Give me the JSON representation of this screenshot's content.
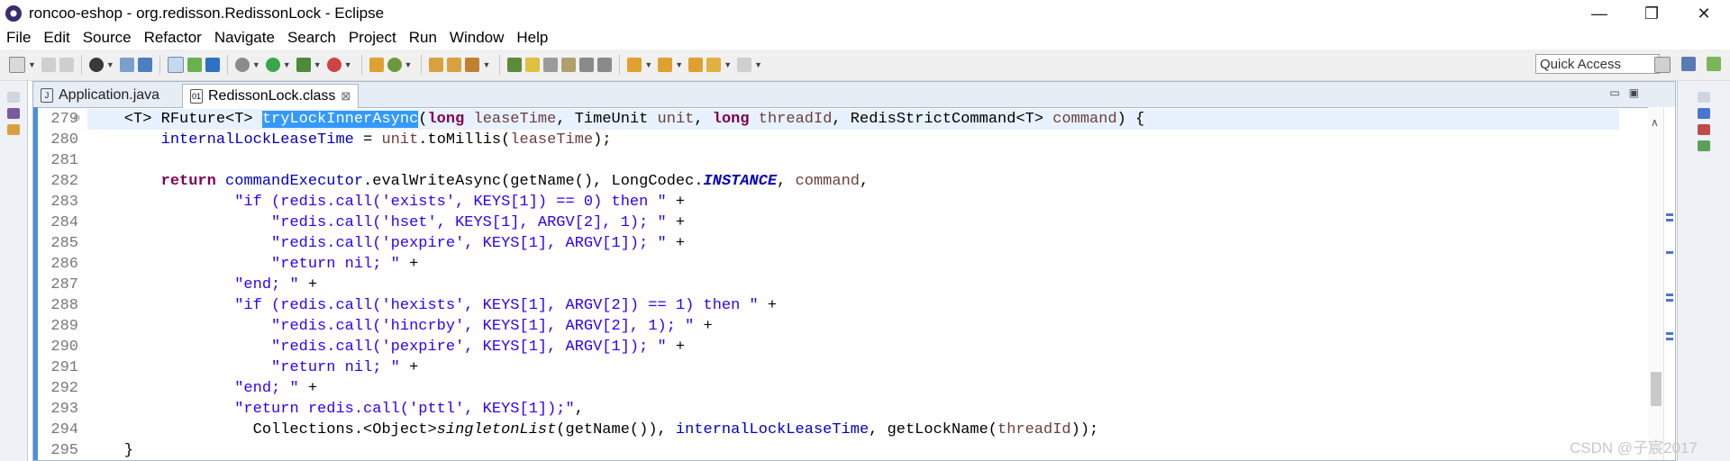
{
  "window": {
    "title": "roncoo-eshop - org.redisson.RedissonLock - Eclipse",
    "minimize": "—",
    "restore": "❐",
    "close": "✕"
  },
  "menu": [
    "File",
    "Edit",
    "Source",
    "Refactor",
    "Navigate",
    "Search",
    "Project",
    "Run",
    "Window",
    "Help"
  ],
  "toolbar": {
    "quick_access": "Quick Access"
  },
  "tabs": [
    {
      "label": "Application.java",
      "icon": "java-file-icon"
    },
    {
      "label": "RedissonLock.class",
      "icon": "class-file-icon",
      "close": "⊠"
    }
  ],
  "editor": {
    "line_numbers": [
      "279",
      "280",
      "281",
      "282",
      "283",
      "284",
      "285",
      "286",
      "287",
      "288",
      "289",
      "290",
      "291",
      "292",
      "293",
      "294",
      "295"
    ],
    "current_line": "279",
    "selected_text": "tryLockInnerAsync",
    "lines": [
      [
        {
          "t": "    <T> RFuture<T> ",
          "c": ""
        },
        {
          "t": "tryLockInnerAsync",
          "c": "sel"
        },
        {
          "t": "(",
          "c": ""
        },
        {
          "t": "long",
          "c": "kw"
        },
        {
          "t": " ",
          "c": ""
        },
        {
          "t": "leaseTime",
          "c": "par"
        },
        {
          "t": ", TimeUnit ",
          "c": ""
        },
        {
          "t": "unit",
          "c": "par"
        },
        {
          "t": ", ",
          "c": ""
        },
        {
          "t": "long",
          "c": "kw"
        },
        {
          "t": " ",
          "c": ""
        },
        {
          "t": "threadId",
          "c": "par"
        },
        {
          "t": ", RedisStrictCommand<T> ",
          "c": ""
        },
        {
          "t": "command",
          "c": "par"
        },
        {
          "t": ") {",
          "c": ""
        }
      ],
      [
        {
          "t": "        ",
          "c": ""
        },
        {
          "t": "internalLockLeaseTime",
          "c": "fld"
        },
        {
          "t": " = ",
          "c": ""
        },
        {
          "t": "unit",
          "c": "par"
        },
        {
          "t": ".toMillis(",
          "c": ""
        },
        {
          "t": "leaseTime",
          "c": "par"
        },
        {
          "t": ");",
          "c": ""
        }
      ],
      [
        {
          "t": "",
          "c": ""
        }
      ],
      [
        {
          "t": "        ",
          "c": ""
        },
        {
          "t": "return",
          "c": "kw"
        },
        {
          "t": " ",
          "c": ""
        },
        {
          "t": "commandExecutor",
          "c": "fld"
        },
        {
          "t": ".evalWriteAsync(getName(), LongCodec.",
          "c": ""
        },
        {
          "t": "INSTANCE",
          "c": "cst"
        },
        {
          "t": ", ",
          "c": ""
        },
        {
          "t": "command",
          "c": "par"
        },
        {
          "t": ",",
          "c": ""
        }
      ],
      [
        {
          "t": "                ",
          "c": ""
        },
        {
          "t": "\"if (redis.call('exists', KEYS[1]) == 0) then \"",
          "c": "str"
        },
        {
          "t": " +",
          "c": ""
        }
      ],
      [
        {
          "t": "                    ",
          "c": ""
        },
        {
          "t": "\"redis.call('hset', KEYS[1], ARGV[2], 1); \"",
          "c": "str"
        },
        {
          "t": " +",
          "c": ""
        }
      ],
      [
        {
          "t": "                    ",
          "c": ""
        },
        {
          "t": "\"redis.call('pexpire', KEYS[1], ARGV[1]); \"",
          "c": "str"
        },
        {
          "t": " +",
          "c": ""
        }
      ],
      [
        {
          "t": "                    ",
          "c": ""
        },
        {
          "t": "\"return nil; \"",
          "c": "str"
        },
        {
          "t": " +",
          "c": ""
        }
      ],
      [
        {
          "t": "                ",
          "c": ""
        },
        {
          "t": "\"end; \"",
          "c": "str"
        },
        {
          "t": " +",
          "c": ""
        }
      ],
      [
        {
          "t": "                ",
          "c": ""
        },
        {
          "t": "\"if (redis.call('hexists', KEYS[1], ARGV[2]) == 1) then \"",
          "c": "str"
        },
        {
          "t": " +",
          "c": ""
        }
      ],
      [
        {
          "t": "                    ",
          "c": ""
        },
        {
          "t": "\"redis.call('hincrby', KEYS[1], ARGV[2], 1); \"",
          "c": "str"
        },
        {
          "t": " +",
          "c": ""
        }
      ],
      [
        {
          "t": "                    ",
          "c": ""
        },
        {
          "t": "\"redis.call('pexpire', KEYS[1], ARGV[1]); \"",
          "c": "str"
        },
        {
          "t": " +",
          "c": ""
        }
      ],
      [
        {
          "t": "                    ",
          "c": ""
        },
        {
          "t": "\"return nil; \"",
          "c": "str"
        },
        {
          "t": " +",
          "c": ""
        }
      ],
      [
        {
          "t": "                ",
          "c": ""
        },
        {
          "t": "\"end; \"",
          "c": "str"
        },
        {
          "t": " +",
          "c": ""
        }
      ],
      [
        {
          "t": "                ",
          "c": ""
        },
        {
          "t": "\"return redis.call('pttl', KEYS[1]);\"",
          "c": "str"
        },
        {
          "t": ",",
          "c": ""
        }
      ],
      [
        {
          "t": "                  Collections.<Object>",
          "c": ""
        },
        {
          "t": "singletonList",
          "c": "ital"
        },
        {
          "t": "(getName()), ",
          "c": ""
        },
        {
          "t": "internalLockLeaseTime",
          "c": "fld"
        },
        {
          "t": ", getLockName(",
          "c": ""
        },
        {
          "t": "threadId",
          "c": "par"
        },
        {
          "t": "));",
          "c": ""
        }
      ],
      [
        {
          "t": "    }",
          "c": ""
        }
      ]
    ]
  },
  "watermark": "CSDN @子宸2017",
  "colors": {
    "keyword": "#7f0055",
    "field": "#0000c0",
    "string": "#2a00ff",
    "parameter": "#6a3e3e",
    "selection": "#3399ff",
    "current_line": "#e8f2fe"
  }
}
